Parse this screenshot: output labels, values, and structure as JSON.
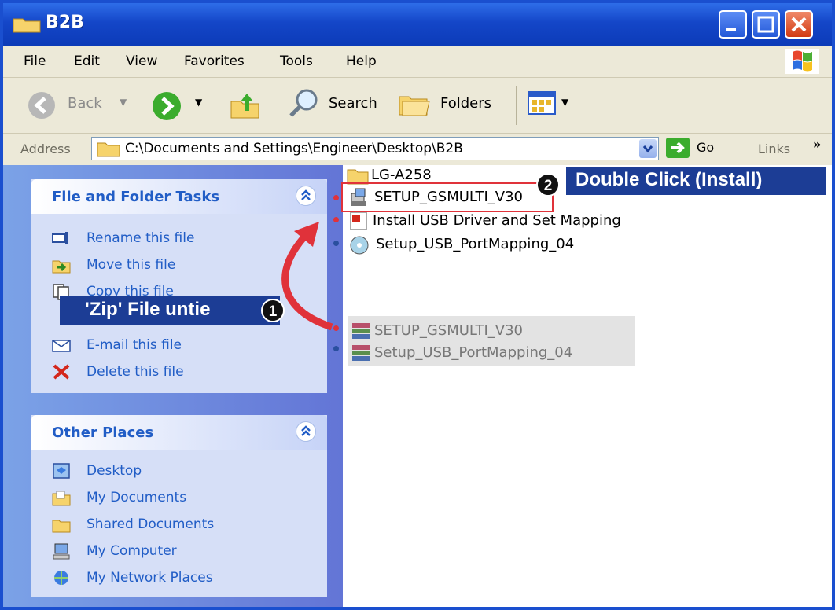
{
  "window": {
    "title": "B2B"
  },
  "menu": [
    "File",
    "Edit",
    "View",
    "Favorites",
    "Tools",
    "Help"
  ],
  "toolbar": {
    "back": "Back",
    "search": "Search",
    "folders": "Folders"
  },
  "address": {
    "label": "Address",
    "path": "C:\\Documents and Settings\\Engineer\\Desktop\\B2B",
    "go": "Go",
    "links": "Links"
  },
  "tasks": {
    "title": "File and Folder Tasks",
    "items": [
      "Rename this file",
      "Move this file",
      "Copy this file",
      "E-mail this file",
      "Delete this file"
    ]
  },
  "places": {
    "title": "Other Places",
    "items": [
      "Desktop",
      "My Documents",
      "Shared Documents",
      "My Computer",
      "My Network Places"
    ]
  },
  "files": [
    {
      "name": "LG-A258"
    },
    {
      "name": "SETUP_GSMULTI_V30"
    },
    {
      "name": "Install USB Driver and Set Mapping"
    },
    {
      "name": "Setup_USB_PortMapping_04"
    },
    {
      "name": "SETUP_GSMULTI_V30"
    },
    {
      "name": "Setup_USB_PortMapping_04"
    }
  ],
  "annotations": {
    "step1": {
      "number": "1",
      "text": "'Zip' File untie"
    },
    "step2": {
      "number": "2",
      "text": "Double Click (Install)"
    }
  },
  "colors": {
    "title_bar": "#1446c8",
    "banner": "#1c3d95",
    "arrow": "#e0323a",
    "link_text": "#215dc6"
  }
}
